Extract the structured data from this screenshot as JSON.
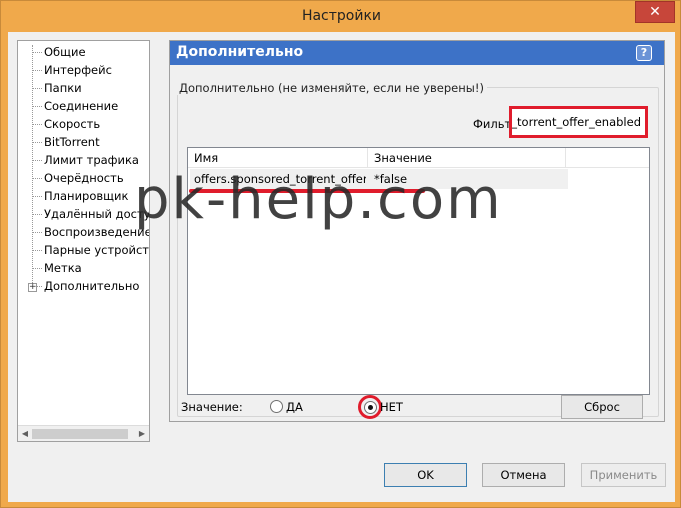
{
  "window": {
    "title": "Настройки",
    "close_glyph": "✕"
  },
  "tree": {
    "items": [
      "Общие",
      "Интерфейс",
      "Папки",
      "Соединение",
      "Скорость",
      "BitTorrent",
      "Лимит трафика",
      "Очерёдность",
      "Планировщик",
      "Удалённый доступ",
      "Воспроизведение",
      "Парные устройства",
      "Метка",
      "Дополнительно"
    ],
    "expander_glyph": "+"
  },
  "panel": {
    "title": "Дополнительно",
    "help_glyph": "?",
    "group_label": "Дополнительно (не изменяйте, если не уверены!)",
    "filter_label": "Фильтр",
    "filter_value": "d_torrent_offer_enabled"
  },
  "list": {
    "columns": [
      "Имя",
      "Значение"
    ],
    "rows": [
      {
        "name": "offers.sponsored_torrent_offer...",
        "value": "*false"
      }
    ]
  },
  "value_row": {
    "label": "Значение:",
    "yes": "ДА",
    "no": "НЕТ",
    "selected": "no",
    "reset_label": "Сброс"
  },
  "buttons": {
    "ok": "OK",
    "cancel": "Отмена",
    "apply": "Применить"
  },
  "watermark": "pk-help.com",
  "colors": {
    "titlebar": "#f0a94b",
    "header": "#3d72c7",
    "highlight": "#e01c2c"
  }
}
